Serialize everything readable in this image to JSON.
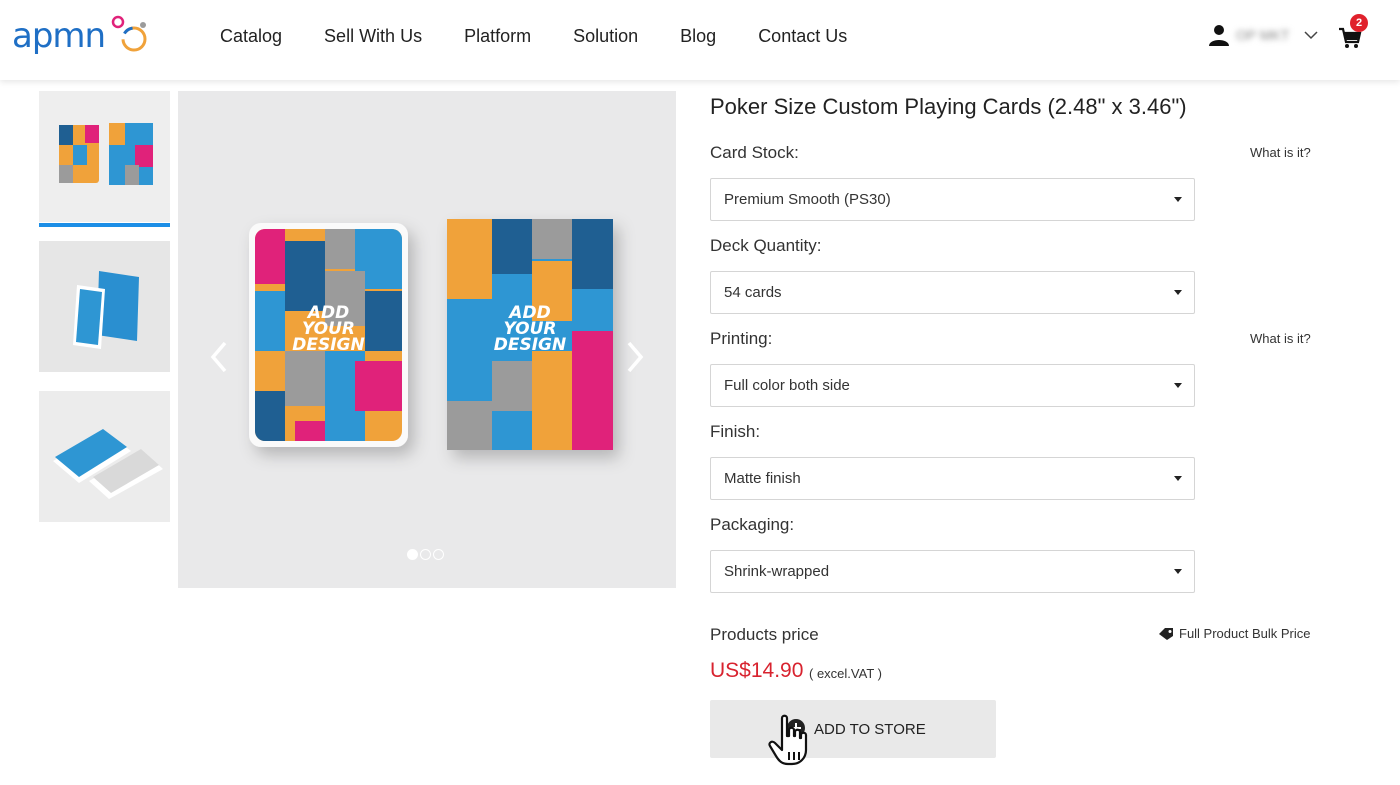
{
  "header": {
    "logo_text": "apmn",
    "nav": [
      "Catalog",
      "Sell With Us",
      "Platform",
      "Solution",
      "Blog",
      "Contact Us"
    ],
    "user_name": "OP MKT",
    "cart_count": "2"
  },
  "gallery": {
    "card_text": [
      "ADD",
      "YOUR",
      "DESIGN"
    ],
    "active_slide": 1,
    "slide_count": 3
  },
  "product": {
    "title": "Poker Size Custom Playing Cards (2.48\" x 3.46\")",
    "what_is_it": "What is it?",
    "fields": [
      {
        "label": "Card Stock:",
        "value": "Premium Smooth (PS30)"
      },
      {
        "label": "Deck Quantity:",
        "value": "54 cards"
      },
      {
        "label": "Printing:",
        "value": "Full color both side"
      },
      {
        "label": "Finish:",
        "value": "Matte finish"
      },
      {
        "label": "Packaging:",
        "value": "Shrink-wrapped"
      }
    ],
    "price_label": "Products price",
    "bulk_label": "Full Product Bulk Price",
    "price": "US$14.90",
    "vat_note": "( excel.VAT )",
    "add_button": "ADD TO STORE"
  },
  "colors": {
    "brand_blue": "#1f6fc5",
    "price_red": "#d8232f",
    "accent_bar": "#1c8ee6",
    "card_orange": "#f0a23a",
    "card_blue": "#2e96d3",
    "card_navy": "#1f5f92",
    "card_pink": "#e0227a",
    "card_gray": "#9b9b9b"
  },
  "icons": [
    "user-icon",
    "chevron-down-icon",
    "cart-icon",
    "arrow-left-icon",
    "arrow-right-icon",
    "tag-icon",
    "hand-cursor-icon"
  ]
}
